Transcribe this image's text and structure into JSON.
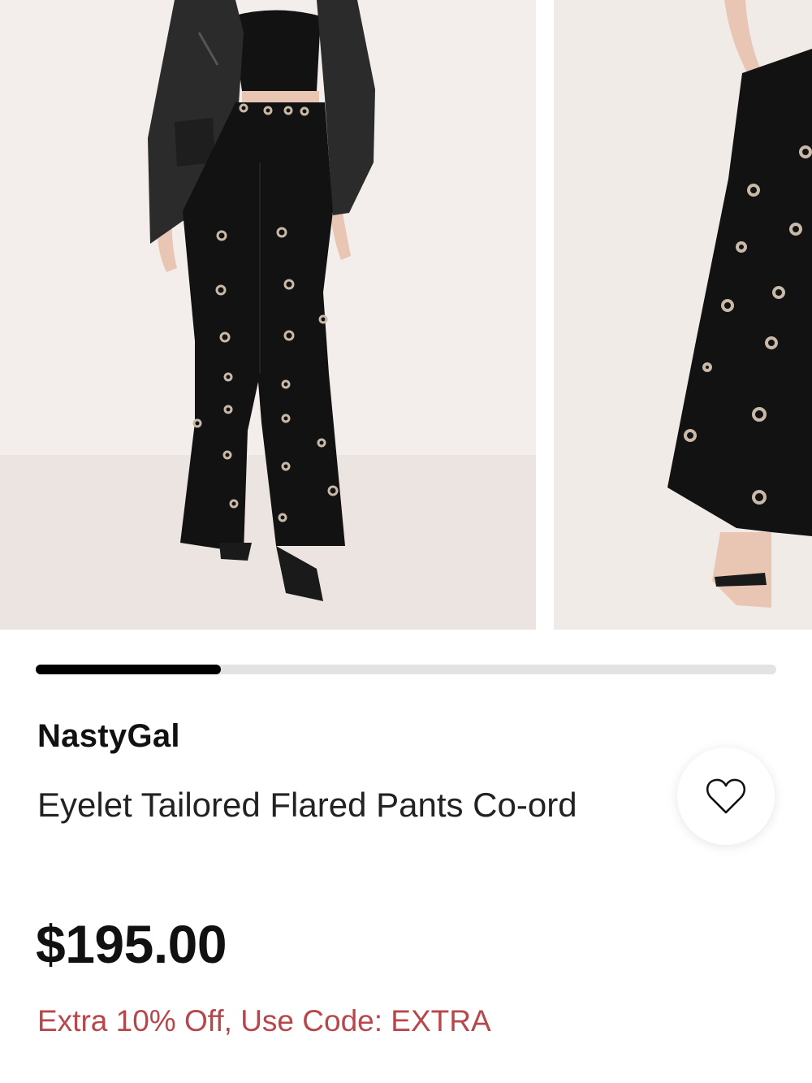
{
  "product": {
    "brand": "NastyGal",
    "name": "Eyelet Tailored Flared Pants Co-ord",
    "price": "$195.00",
    "promo": "Extra 10% Off, Use Code: EXTRA"
  },
  "gallery": {
    "image_count_shown": 2,
    "scroll_progress": 0.25
  },
  "icons": {
    "wishlist": "heart-outline-icon"
  },
  "colors": {
    "promo": "#b7474a",
    "text": "#111111",
    "scroll_thumb": "#000000",
    "scroll_track": "#e3e3e3",
    "photo_bg": "#f1ebe8"
  }
}
